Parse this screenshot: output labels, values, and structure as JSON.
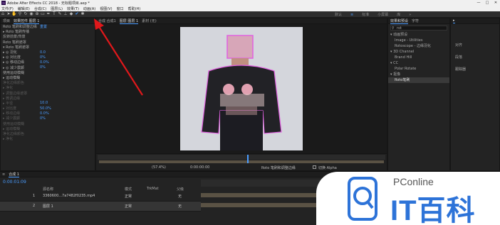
{
  "window": {
    "title": "Adobe After Effects CC 2018 - 无标题项目.aep *",
    "logo": "Ae"
  },
  "window_controls": [
    "—",
    "□",
    "✕"
  ],
  "menu": [
    "文件(F)",
    "编辑(E)",
    "合成(C)",
    "图层(L)",
    "效果(T)",
    "动画(A)",
    "视图(V)",
    "窗口",
    "帮助(H)"
  ],
  "workspaces": [
    "默认",
    "≡",
    "标准",
    "小屏幕",
    "库",
    "»"
  ],
  "effects_panel": {
    "tabs": [
      "项目",
      "效果控件 图层 1"
    ],
    "rows": [
      {
        "label": "Roto 笔刷和调整边缘",
        "value": "重置"
      },
      {
        "label": "▸ Roto 笔刷传播",
        "value": ""
      },
      {
        "label": "反转前景/背景",
        "value": ""
      },
      {
        "label": "Roto 笔刷遮罩",
        "value": ""
      },
      {
        "label": "▾ Roto 笔刷遮罩",
        "value": ""
      },
      {
        "label": "▸ ◎ 羽化",
        "value": "0.0"
      },
      {
        "label": "▸ ◎ 对比度",
        "value": "0%"
      },
      {
        "label": "▸ ◎ 移动边缘",
        "value": "0.0%"
      },
      {
        "label": "▸ ◎ 减少震颤",
        "value": "0%"
      },
      {
        "label": "使用运动模糊",
        "value": ""
      },
      {
        "label": "▸ 运动模糊",
        "value": ""
      },
      {
        "label": "净化边缘颜色",
        "value": ""
      },
      {
        "label": "▸ 净化",
        "value": ""
      },
      {
        "label": "▸ 调整边缘遮罩",
        "value": ""
      },
      {
        "label": "▸ 微调边缘",
        "value": ""
      },
      {
        "label": "▸ 半径",
        "value": "10.0"
      },
      {
        "label": "▸ 对比度",
        "value": "50.0%"
      },
      {
        "label": "▸ 移动边缘",
        "value": "0.0%"
      },
      {
        "label": "▸ 减少震颤",
        "value": "0%"
      },
      {
        "label": "使用运动模糊",
        "value": ""
      },
      {
        "label": "▸ 运动模糊",
        "value": ""
      },
      {
        "label": "净化边缘颜色",
        "value": ""
      },
      {
        "label": "▸ 净化",
        "value": ""
      }
    ]
  },
  "composition": {
    "tabs": [
      "合成 合成1",
      "图层 图层 1",
      "素材 (无)"
    ],
    "viewer_zoom": "(57.4%)",
    "timecode": "0:00:00:00",
    "bottom_label": "Roto 笔刷和调整边缘",
    "toggle": "切换 Alpha"
  },
  "effects_presets": {
    "tabs": [
      "效果和预设",
      "字符"
    ],
    "search": "rot",
    "items": [
      "▾ 动画预设",
      "Image - Utilities",
      "Rotoscope - 边缘羽化",
      "▾ 3D Channel",
      "Brand Hill",
      "▾ CC",
      "Polar Rotate",
      "▾ 抠像",
      "Roto笔刷"
    ]
  },
  "right_panel": {
    "items": [
      "对齐",
      "段落",
      "跟踪器"
    ]
  },
  "timeline": {
    "tab": "合成 1",
    "timecode": "0:00:01:09",
    "headers": [
      "源名称",
      "模式",
      "TrkMat",
      "父级"
    ],
    "layers": [
      {
        "num": "1",
        "name": "3360600...7a7482f0235.mp4",
        "mode": "正常",
        "parent": "无"
      },
      {
        "num": "2",
        "name": "图层 1",
        "mode": "正常",
        "parent": "无"
      }
    ]
  },
  "watermark": {
    "brand": "PConline",
    "text": "IT百科"
  }
}
